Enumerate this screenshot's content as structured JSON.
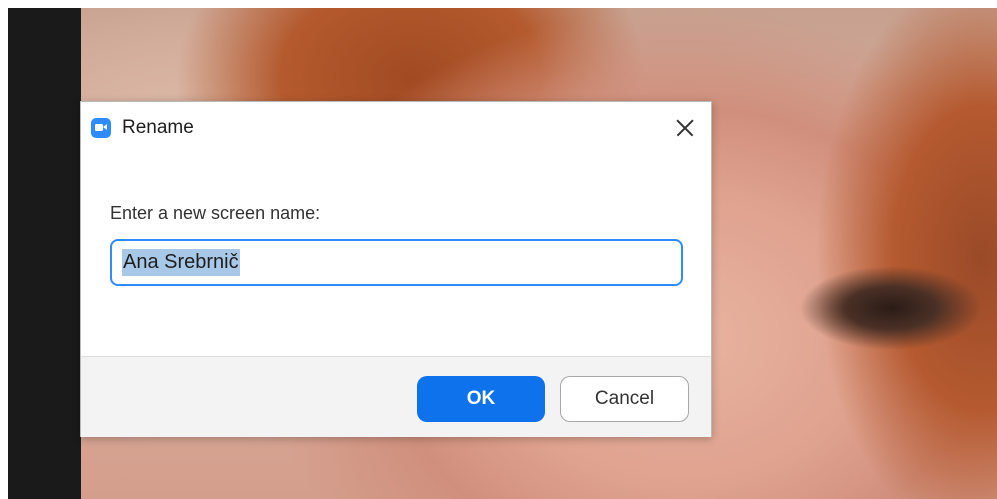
{
  "dialog": {
    "title": "Rename",
    "app_icon": "video-camera-icon",
    "close_icon": "close-icon",
    "prompt": "Enter a new screen name:",
    "input_value": "Ana Srebrnič",
    "ok_label": "OK",
    "cancel_label": "Cancel"
  },
  "colors": {
    "accent": "#0e72ed",
    "icon_bg": "#2d8cff",
    "selection": "#a8c8e8"
  }
}
